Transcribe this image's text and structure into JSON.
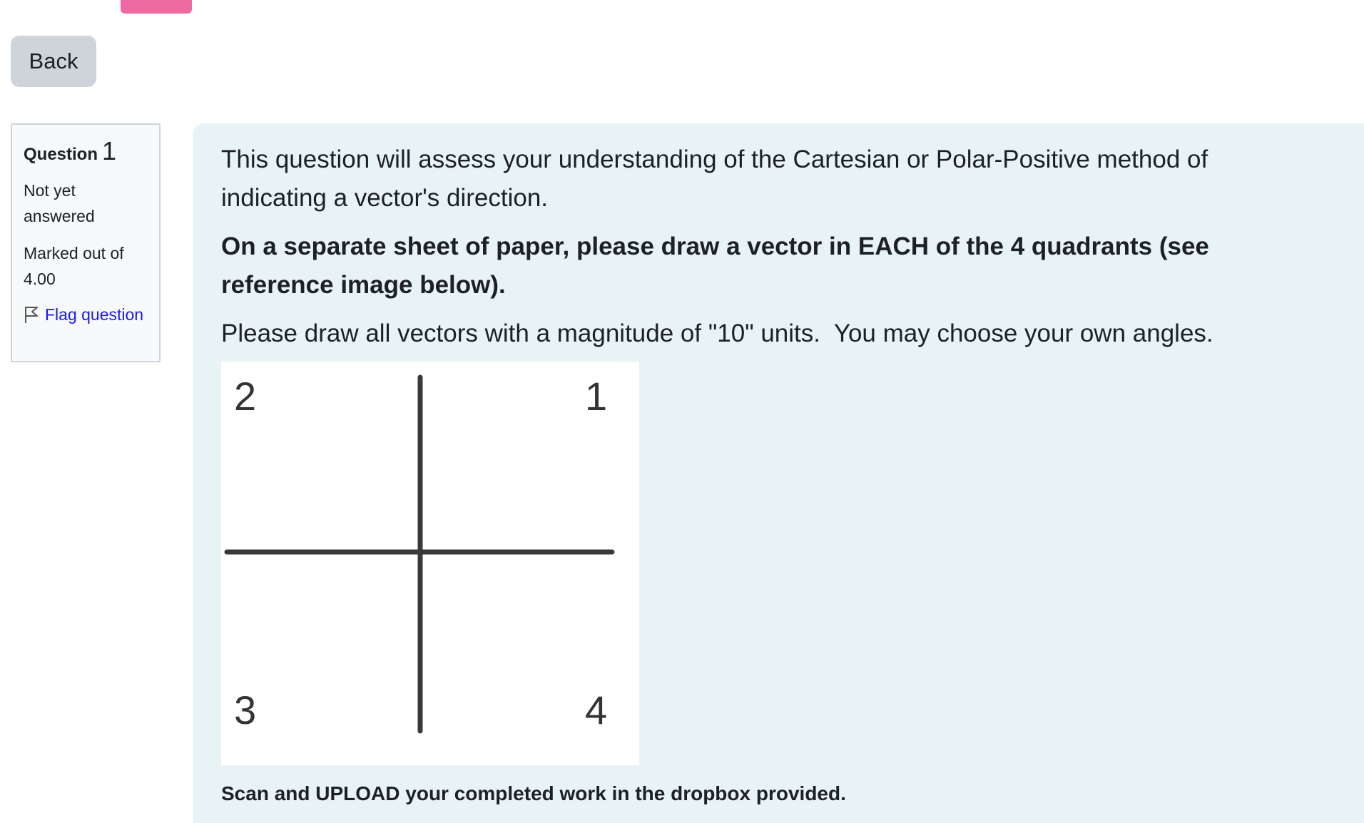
{
  "back_button": {
    "label": "Back"
  },
  "question_info": {
    "label": "Question",
    "number": "1",
    "state": "Not yet answered",
    "grade": "Marked out of 4.00",
    "flag_label": "Flag question"
  },
  "question": {
    "intro": "This question will assess your understanding of the Cartesian or Polar-Positive method of indicating a vector's direction.",
    "instruction": "On a separate sheet of paper, please draw a vector in EACH of the 4 quadrants (see reference image below).",
    "magnitude_note": "Please draw all vectors with a magnitude of \"10\" units.  You may choose your own angles.",
    "upload_note": "Scan and UPLOAD your completed work in the dropbox provided.",
    "reference_image": {
      "quadrant_labels": [
        "2",
        "1",
        "3",
        "4"
      ]
    }
  },
  "colors": {
    "back_button_bg": "#ced4da",
    "content_bg": "#e7f3f5",
    "link": "#1a1aee",
    "top_pink": "#ef6aa2"
  }
}
